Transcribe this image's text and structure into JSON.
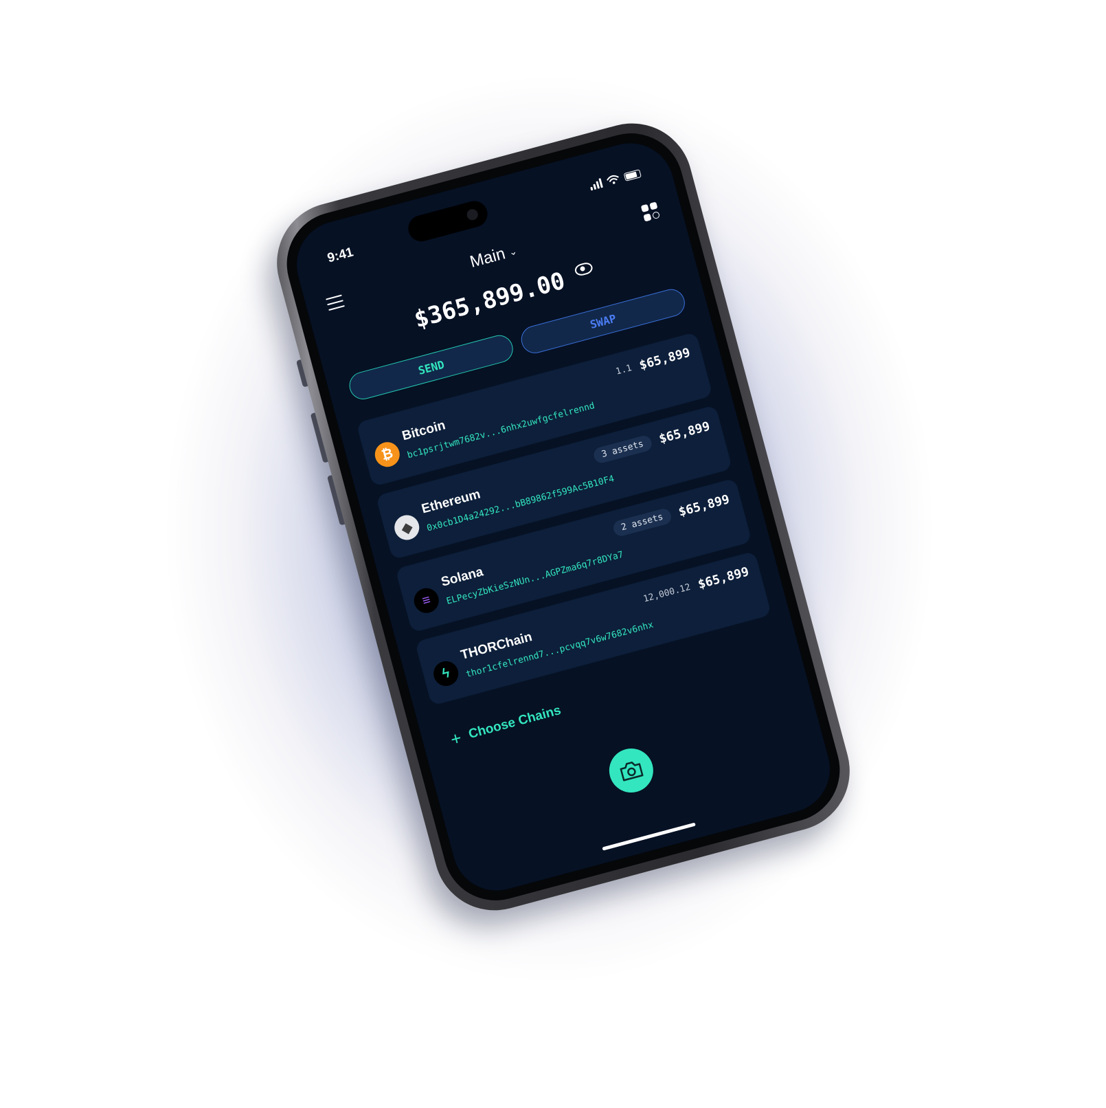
{
  "status_bar": {
    "time": "9:41"
  },
  "header": {
    "vault_name": "Main",
    "chevron": "chevron-down-icon"
  },
  "balance": {
    "total": "$365,899.00"
  },
  "actions": {
    "send_label": "SEND",
    "swap_label": "SWAP"
  },
  "chains": [
    {
      "name": "Bitcoin",
      "amount": "1.1",
      "badge": "",
      "value": "$65,899",
      "address": "bc1psrjtwm7682v...6nhx2uwfgcfelrennd",
      "logo_text": "₿",
      "logo_bg": "#f7931a",
      "logo_fg": "#ffffff"
    },
    {
      "name": "Ethereum",
      "amount": "",
      "badge": "3 assets",
      "value": "$65,899",
      "address": "0x0cb1D4a24292...bB89862f599Ac5B10F4",
      "logo_text": "◆",
      "logo_bg": "#e4e6ea",
      "logo_fg": "#3c3c3d"
    },
    {
      "name": "Solana",
      "amount": "",
      "badge": "2 assets",
      "value": "$65,899",
      "address": "ELPecyZbKieSzNUn...AGPZma6q7r8DYa7",
      "logo_text": "≡",
      "logo_bg": "#000000",
      "logo_fg": "#9b5cf6"
    },
    {
      "name": "THORChain",
      "amount": "12,000.12",
      "badge": "",
      "value": "$65,899",
      "address": "thor1cfelrennd7...pcvqq7v6w7682v6nhx",
      "logo_text": "ϟ",
      "logo_bg": "#000000",
      "logo_fg": "#33e6bf"
    }
  ],
  "add_chains": {
    "label": "Choose Chains"
  },
  "colors": {
    "background": "#061124",
    "card": "#0d1f3a",
    "accent": "#33e6bf",
    "swap_accent": "#4b7cf3"
  }
}
